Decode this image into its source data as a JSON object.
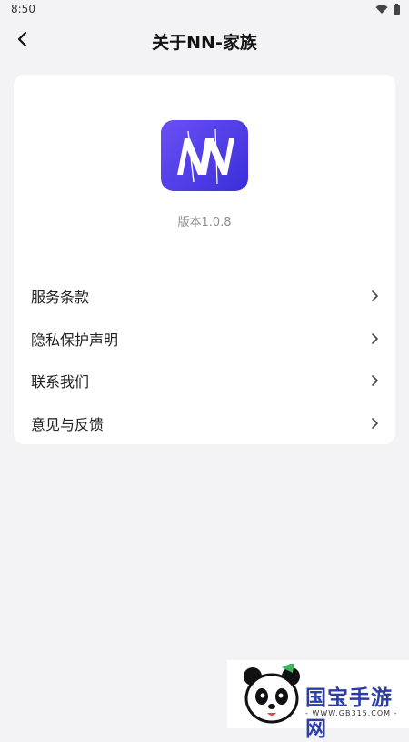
{
  "status_bar": {
    "time": "8:50"
  },
  "header": {
    "title": "关于NN-家族"
  },
  "app": {
    "version": "版本1.0.8"
  },
  "menu": {
    "items": [
      {
        "label": "服务条款"
      },
      {
        "label": "隐私保护声明"
      },
      {
        "label": "联系我们"
      },
      {
        "label": "意见与反馈"
      }
    ]
  },
  "watermark": {
    "name": "国宝手游网",
    "url": "- WWW.GB315.COM -"
  },
  "colors": {
    "background": "#f3f3f5",
    "card": "#ffffff",
    "logo_accent": "#4d3ce8"
  }
}
